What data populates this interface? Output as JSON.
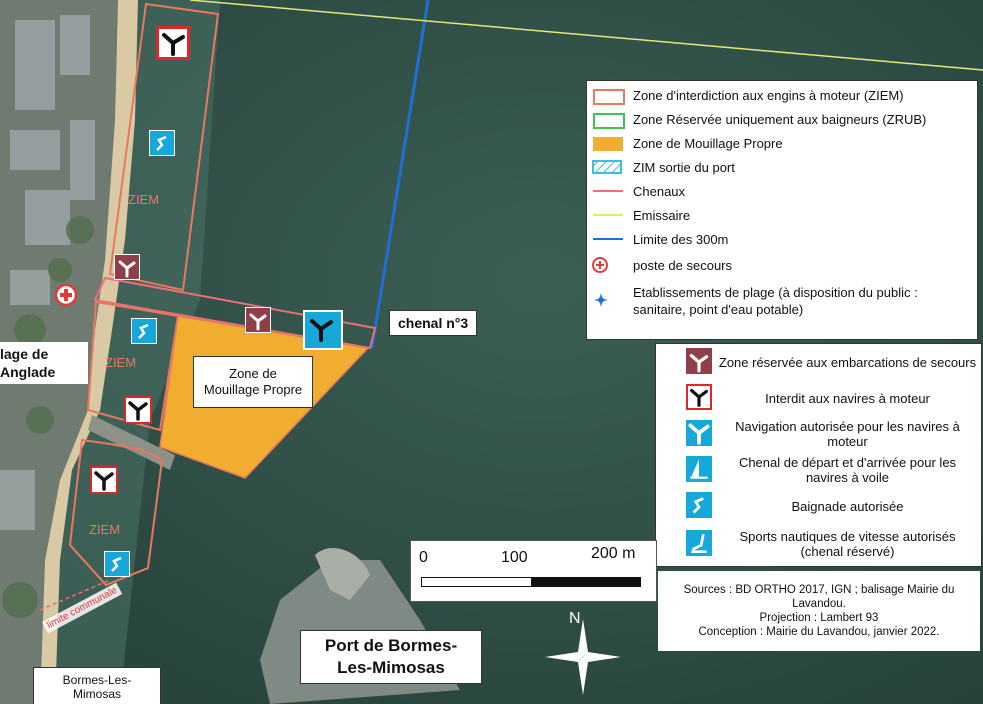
{
  "map": {
    "zone_labels": [
      "ZIEM",
      "ZIEM",
      "ZIEM"
    ],
    "mooring_zone_label": "Zone de\nMouillage Propre",
    "channel_label": "chenal n°3",
    "beach_label": "lage de\nAnglade",
    "port_label": "Port de Bormes-\nLes-Mimosas",
    "commune_limit_label": "limite communale",
    "town_label": "Bormes-Les-\nMimosas",
    "north_label": "N"
  },
  "colors": {
    "ziem": "#e8795e",
    "zrub": "#3fc24f",
    "mooring": "#f0ad2f",
    "zim": "#34c4d8",
    "chenaux": "#ef6d78",
    "emissaire": "#e7e67a",
    "limit300": "#1e6fd8",
    "sea": "#2f5247",
    "rescue_sign": "#8e3f4a",
    "sign_blue": "#15a8d8"
  },
  "legend_lines": {
    "items": [
      {
        "label": "Zone d'interdiction aux engins à moteur (ZIEM)",
        "symbol": "outline-ziem"
      },
      {
        "label": "Zone Réservée uniquement aux baigneurs (ZRUB)",
        "symbol": "outline-zrub"
      },
      {
        "label": "Zone de Mouillage Propre",
        "symbol": "fill-mooring"
      },
      {
        "label": "ZIM sortie du port",
        "symbol": "hatch-zim"
      },
      {
        "label": "Chenaux",
        "symbol": "line-chenaux"
      },
      {
        "label": "Emissaire",
        "symbol": "line-emissaire"
      },
      {
        "label": "Limite des 300m",
        "symbol": "line-300m"
      },
      {
        "label": "poste de secours",
        "symbol": "rescue-cross-icon"
      },
      {
        "label": "Etablissements de plage (à disposition du public :\nsanitaire,  point d'eau potable)",
        "symbol": "beach-facility-icon"
      }
    ]
  },
  "legend_signs": {
    "items": [
      {
        "label": "Zone réservée aux embarcations de secours",
        "icon": "rescue-boat-sign-icon"
      },
      {
        "label": "Interdit aux navires à moteur",
        "icon": "motor-prohibited-sign-icon"
      },
      {
        "label": "Navigation autorisée pour les navires à moteur",
        "icon": "motor-allowed-sign-icon"
      },
      {
        "label": "Chenal de départ et d'arrivée pour les navires à voile",
        "icon": "sailing-channel-sign-icon"
      },
      {
        "label": "Baignade autorisée",
        "icon": "swimming-allowed-sign-icon"
      },
      {
        "label": "Sports nautiques de vitesse autorisés (chenal réservé)",
        "icon": "watersports-sign-icon"
      }
    ]
  },
  "scale": {
    "t0": "0",
    "t1": "100",
    "t2": "200 m"
  },
  "sources": {
    "line1": "Sources : BD ORTHO 2017, IGN ; balisage Mairie du Lavandou.",
    "line2": "Projection : Lambert 93",
    "line3": "Conception : Mairie du Lavandou, janvier 2022."
  }
}
